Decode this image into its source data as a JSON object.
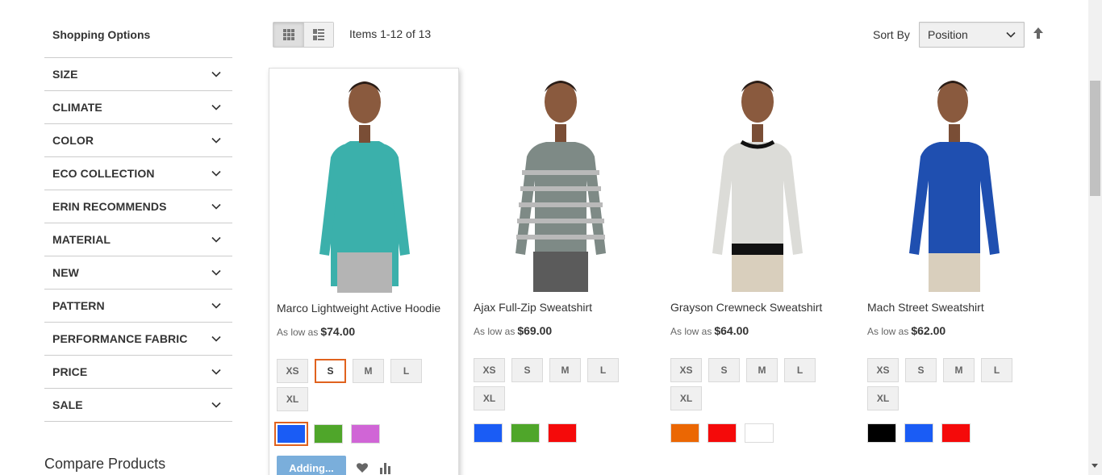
{
  "sidebar": {
    "title": "Shopping Options",
    "filters": [
      "SIZE",
      "CLIMATE",
      "COLOR",
      "ECO COLLECTION",
      "ERIN RECOMMENDS",
      "MATERIAL",
      "NEW",
      "PATTERN",
      "PERFORMANCE FABRIC",
      "PRICE",
      "SALE"
    ],
    "compare_title": "Compare Products"
  },
  "toolbar": {
    "grid_icon": "grid-icon",
    "list_icon": "list-icon",
    "amount": "Items 1-12 of 13",
    "sort_label": "Sort By",
    "sort_value": "Position"
  },
  "products": [
    {
      "name": "Marco Lightweight Active Hoodie",
      "price_prefix": "As low as",
      "price": "$74.00",
      "sizes": [
        "XS",
        "S",
        "M",
        "L",
        "XL"
      ],
      "selected_size": "S",
      "swatches": [
        "#1a5cf5",
        "#4fa62a",
        "#d065d6"
      ],
      "selected_swatch": 0,
      "shirt_color": "#3bb0ab",
      "add_label": "Adding...",
      "wishlist_icon": "heart-icon",
      "compare_icon": "bar-chart-icon"
    },
    {
      "name": "Ajax Full-Zip Sweatshirt",
      "price_prefix": "As low as",
      "price": "$69.00",
      "sizes": [
        "XS",
        "S",
        "M",
        "L",
        "XL"
      ],
      "swatches": [
        "#1a5cf5",
        "#4fa62a",
        "#f50a0a"
      ],
      "shirt_color": "#7e8a86"
    },
    {
      "name": "Grayson Crewneck Sweatshirt",
      "price_prefix": "As low as",
      "price": "$64.00",
      "sizes": [
        "XS",
        "S",
        "M",
        "L",
        "XL"
      ],
      "swatches": [
        "#eb6703",
        "#f50a0a",
        "#ffffff"
      ],
      "shirt_color": "#dcdcd8"
    },
    {
      "name": "Mach Street Sweatshirt",
      "price_prefix": "As low as",
      "price": "$62.00",
      "sizes": [
        "XS",
        "S",
        "M",
        "L",
        "XL"
      ],
      "swatches": [
        "#000000",
        "#1a5cf5",
        "#f50a0a"
      ],
      "shirt_color": "#1f4fb0"
    }
  ]
}
